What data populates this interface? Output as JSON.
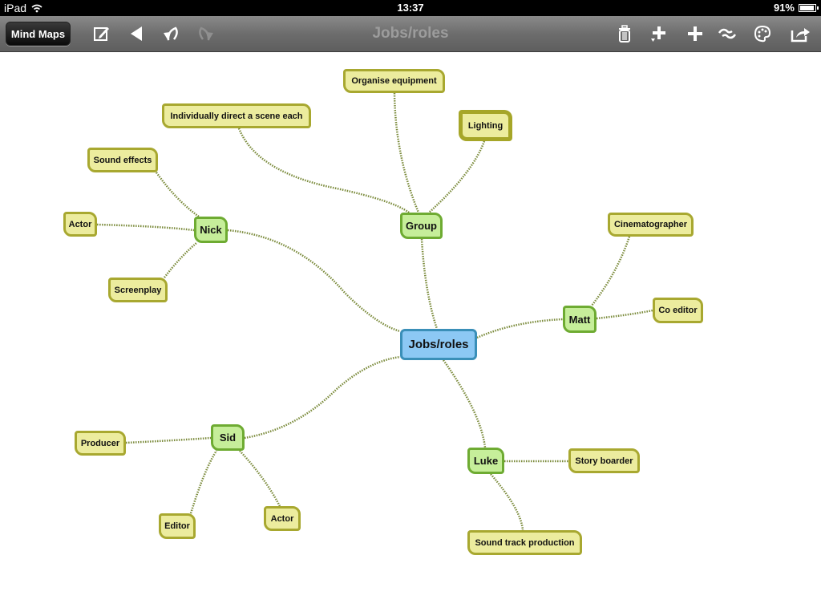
{
  "status_bar": {
    "device": "iPad",
    "time": "13:37",
    "battery": "91%",
    "battery_level": 0.91
  },
  "toolbar": {
    "back_label": "Mind Maps",
    "title": "Jobs/roles",
    "icons": [
      "edit-icon",
      "previous-icon",
      "undo-icon",
      "redo-icon",
      "trash-icon",
      "add-child-icon",
      "add-sibling-icon",
      "link-icon",
      "palette-icon",
      "share-icon"
    ]
  },
  "map": {
    "root": "Jobs/roles",
    "branches": [
      {
        "label": "Group",
        "children": [
          "Organise equipment",
          "Lighting",
          "Individually direct a scene each"
        ]
      },
      {
        "label": "Nick",
        "children": [
          "Sound effects",
          "Actor",
          "Screenplay"
        ]
      },
      {
        "label": "Matt",
        "children": [
          "Cinematographer",
          "Co editor"
        ]
      },
      {
        "label": "Sid",
        "children": [
          "Producer",
          "Editor",
          "Actor"
        ]
      },
      {
        "label": "Luke",
        "children": [
          "Story boarder",
          "Sound track production"
        ]
      }
    ],
    "selected": "Lighting",
    "colors": {
      "root": "#8cc8f4",
      "branch": "#c6ee9a",
      "leaf": "#ecec9e",
      "link": "#7a8a3a"
    }
  }
}
